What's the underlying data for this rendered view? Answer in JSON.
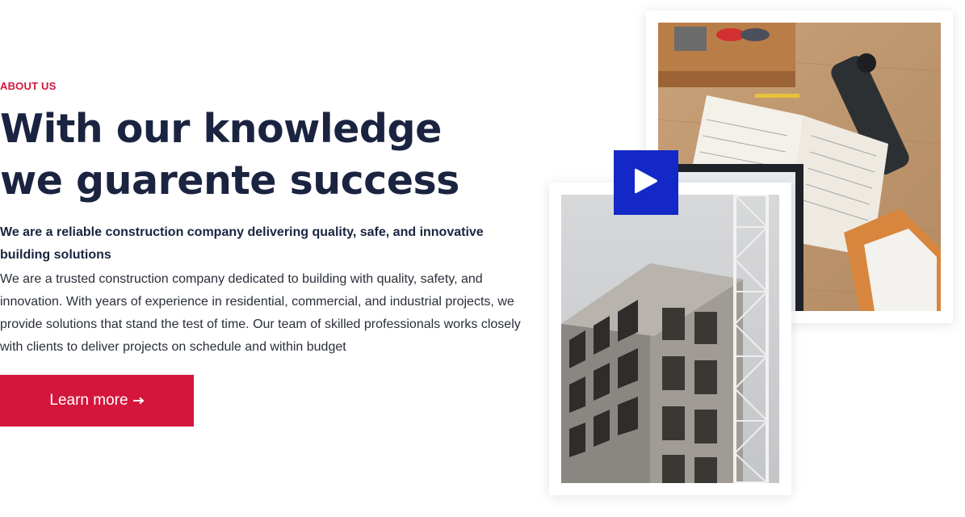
{
  "about": {
    "eyebrow": "ABOUT US",
    "headline_line1": "With our knowledge",
    "headline_line2": "we guarente success",
    "lead": "We are a reliable construction company delivering quality, safe, and innovative building solutions",
    "body": "We are a trusted construction company dedicated to building with quality, safety, and innovation. With years of experience in residential, commercial, and industrial projects, we provide solutions that stand the test of time. Our team of skilled professionals works closely with clients to deliver projects on schedule and within budget",
    "cta_label": "Learn more",
    "cta_icon": "arrow-right-icon"
  },
  "media": {
    "top_photo": "workbench-notebooks-photo",
    "bottom_photo": "building-construction-crane-photo",
    "play_icon": "play-icon"
  },
  "colors": {
    "accent": "#d4163c",
    "heading": "#1a2340",
    "play_button": "#1428c8"
  }
}
